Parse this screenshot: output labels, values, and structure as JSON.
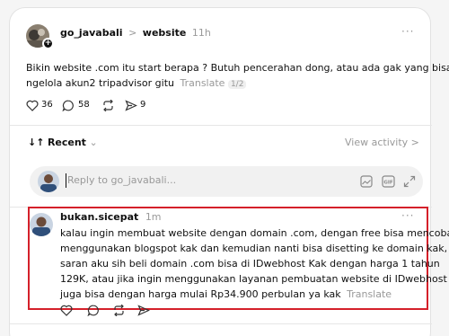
{
  "post": {
    "username": "go_javabali",
    "separator": ">",
    "context": "website",
    "time": "11h",
    "more": "···",
    "body_line1": "Bikin website .com itu start berapa ? Butuh pencerahan dong, atau ada gak yang bisa",
    "body_line2": "ngelola akun2 tripadvisor gitu",
    "translate": "Translate",
    "translate_badge": "1/2",
    "likes": "36",
    "comments": "58",
    "shares": "9"
  },
  "thread": {
    "sort_arrows": "↓↑",
    "sort_label": "Recent",
    "sort_chevron": "⌄",
    "view_activity": "View activity >",
    "reply_placeholder": "Reply to go_javabali..."
  },
  "reply": {
    "username": "bukan.sicepat",
    "time": "1m",
    "more": "···",
    "lines": [
      "kalau ingin membuat website dengan domain .com, dengan free bisa mencoba",
      "menggunakan blogspot kak dan kemudian nanti bisa disetting ke domain kak,",
      "saran aku sih beli domain .com bisa di IDwebhost Kak dengan harga 1 tahun",
      "129K, atau jika ingin menggunakan layanan pembuatan website di IDwebhost"
    ],
    "last_line": "juga bisa dengan harga mulai Rp34.900 perbulan ya kak",
    "translate": "Translate"
  },
  "colors": {
    "highlight": "#d5202a",
    "muted": "#999999",
    "text": "#101010"
  }
}
